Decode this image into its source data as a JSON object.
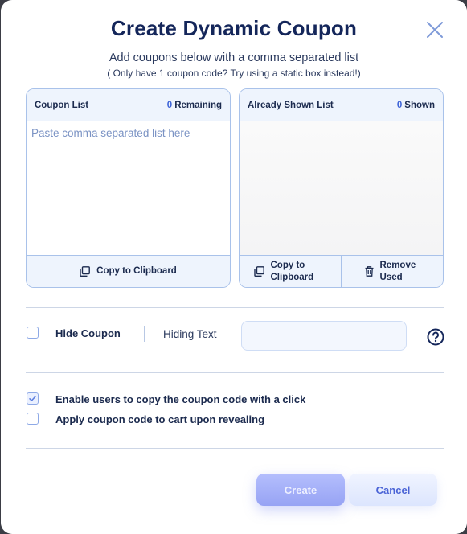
{
  "dialog": {
    "title": "Create Dynamic Coupon",
    "subtitle": "Add coupons below with a comma separated list",
    "subnote": "( Only have 1 coupon code? Try using a static box instead!)",
    "close_icon": "close-icon"
  },
  "coupon_list": {
    "title": "Coupon List",
    "count": "0",
    "count_label": "Remaining",
    "placeholder": "Paste comma separated list here",
    "value": "",
    "copy_label": "Copy to Clipboard"
  },
  "shown_list": {
    "title": "Already Shown List",
    "count": "0",
    "count_label": "Shown",
    "copy_label": "Copy to Clipboard",
    "remove_label": "Remove Used"
  },
  "hide_coupon": {
    "checked": false,
    "label": "Hide Coupon",
    "hiding_text_label": "Hiding Text",
    "hiding_text_value": "",
    "help_icon": "help-icon"
  },
  "options": [
    {
      "label": "Enable users to copy the coupon code with a click",
      "checked": true
    },
    {
      "label": "Apply coupon code to cart upon revealing",
      "checked": false
    }
  ],
  "actions": {
    "create_label": "Create",
    "cancel_label": "Cancel"
  },
  "colors": {
    "title": "#14265a",
    "accent": "#3d63d8",
    "panel_border": "#a9c2ea",
    "panel_header_bg": "#eef4fd"
  }
}
